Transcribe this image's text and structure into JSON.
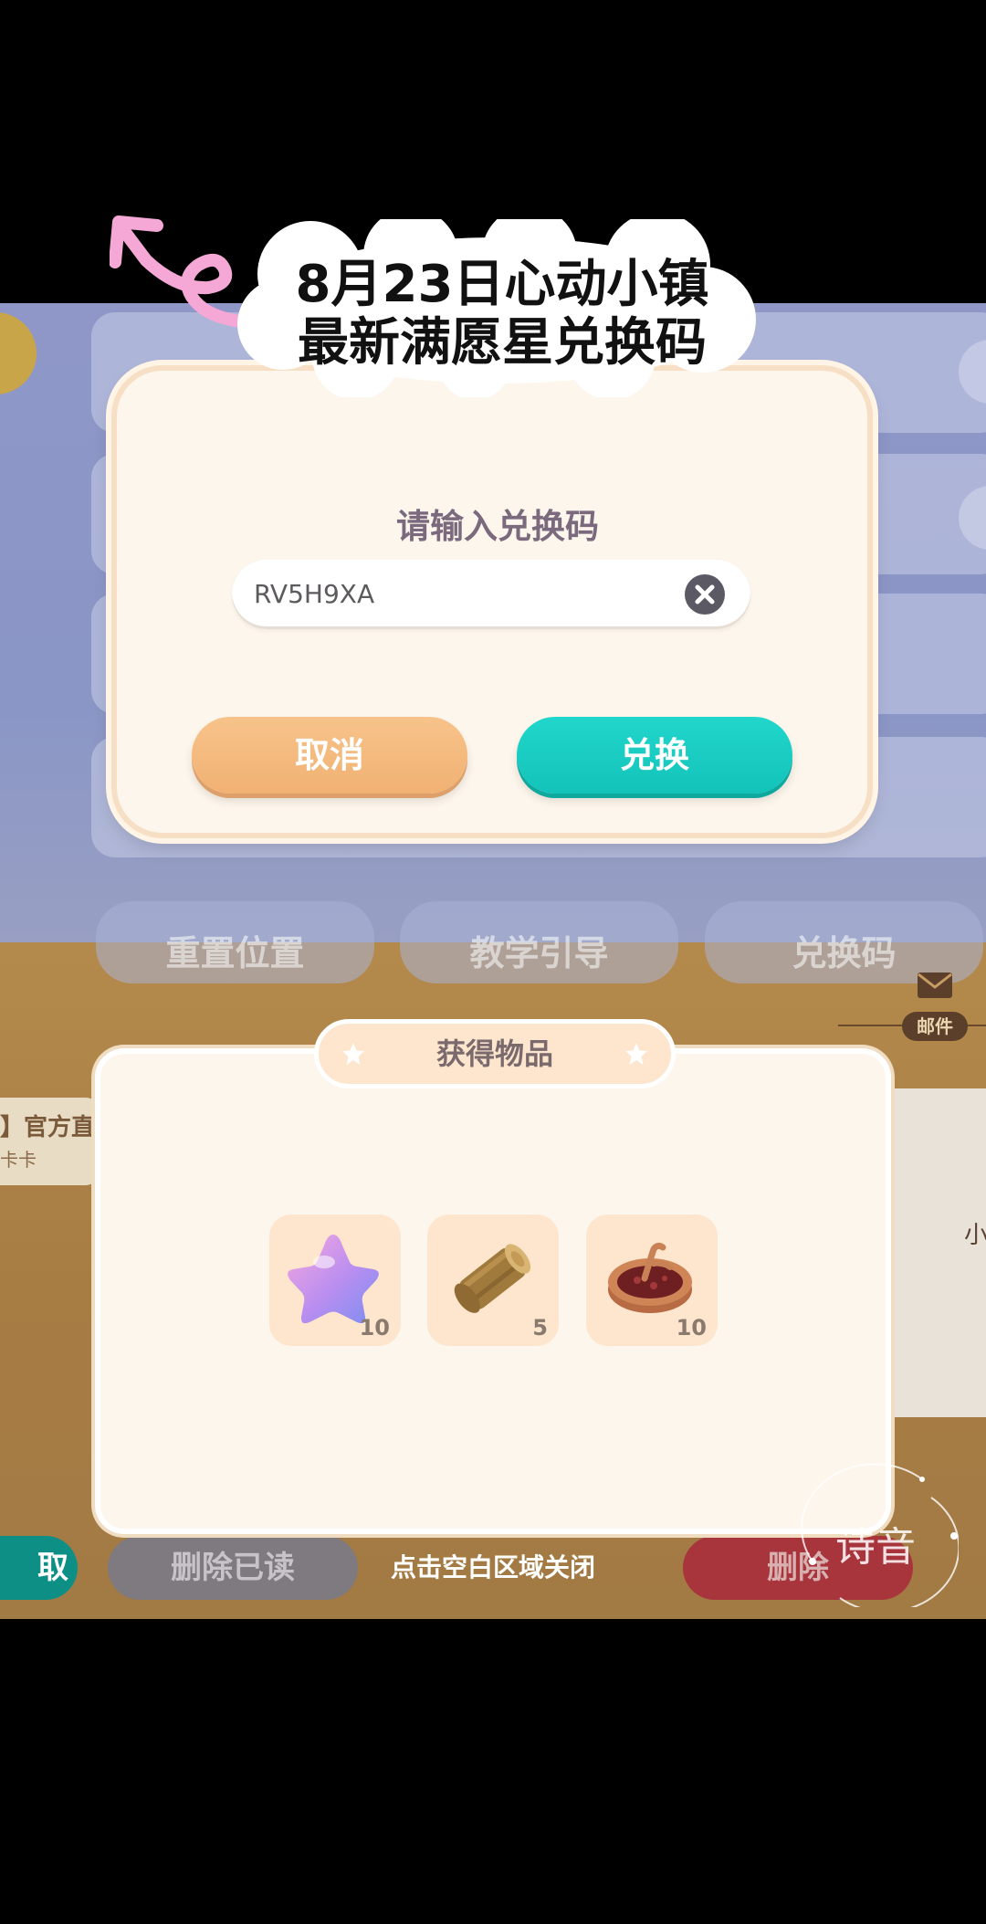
{
  "overlay": {
    "title_line1": "8月23日心动小镇",
    "title_line2": "最新满愿星兑换码"
  },
  "background": {
    "tabs": [
      "重置位置",
      "教学引导",
      "兑换码"
    ],
    "mail_label": "邮件",
    "mail_preview_title": "】官方直",
    "mail_preview_sub": "卡卡",
    "right_peek_text": "小",
    "bottom_left_label": "取",
    "delete_read_label": "删除已读",
    "delete_label": "删除"
  },
  "redeem_dialog": {
    "title": "请输入兑换码",
    "code_value": "RV5H9XA",
    "cancel_label": "取消",
    "confirm_label": "兑换"
  },
  "items_panel": {
    "title": "获得物品",
    "items": [
      {
        "icon": "wish-star-icon",
        "count": "10"
      },
      {
        "icon": "wood-log-icon",
        "count": "5"
      },
      {
        "icon": "pie-icon",
        "count": "10"
      }
    ],
    "close_hint": "点击空白区域关闭"
  },
  "watermark": {
    "text": "诗音"
  },
  "colors": {
    "accent_teal": "#13c3b9",
    "accent_orange": "#f1b173",
    "panel_bg": "#fdf6ec"
  }
}
